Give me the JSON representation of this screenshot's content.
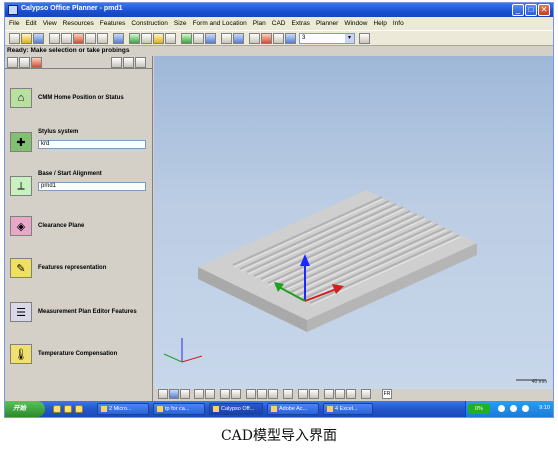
{
  "window": {
    "title": "Calypso Office Planner - pmd1",
    "minimize": "_",
    "maximize": "□",
    "close": "✕"
  },
  "menu": [
    "File",
    "Edit",
    "View",
    "Resources",
    "Features",
    "Construction",
    "Size",
    "Form and Location",
    "Plan",
    "CAD",
    "Extras",
    "Planner",
    "Window",
    "Help",
    "Info"
  ],
  "toolbar": {
    "combo_value": "3",
    "combo_arrow": "▾"
  },
  "status": {
    "message": "Ready: Make selection or take probings"
  },
  "left_panel": {
    "features": [
      {
        "label": "CMM Home Position or Status",
        "icon": "cmm-home-icon"
      },
      {
        "label": "Stylus system",
        "value": "krd",
        "icon": "stylus-icon"
      },
      {
        "label": "Base / Start Alignment",
        "value": "pmd1",
        "icon": "alignment-icon"
      },
      {
        "label": "Clearance Plane",
        "icon": "clearance-plane-icon"
      },
      {
        "label": "Features representation",
        "icon": "features-representation-icon"
      },
      {
        "label": "Measurement Plan Editor Features",
        "icon": "plan-editor-icon"
      },
      {
        "label": "Temperature Compensation",
        "icon": "temperature-icon"
      }
    ]
  },
  "viewport": {
    "scale_label": "40 mm"
  },
  "view_toolbar": {
    "label": "FR"
  },
  "taskbar": {
    "start_label": "开始",
    "tasks": [
      "2 Micro...",
      "tp for ca...",
      "Calypso Off...",
      "Adobe Ac...",
      "4 Excel..."
    ],
    "tray_badge": "0%",
    "clock": "9:10"
  },
  "caption": "CAD模型导入界面",
  "colors": {
    "titlebar": "#1a4fd0",
    "viewport_top": "#9fb8d8",
    "viewport_bottom": "#c8d7ea",
    "part": "#c4c4c4",
    "axis_blue": "#1a2aff",
    "axis_red": "#d02020",
    "axis_green": "#20a020"
  }
}
